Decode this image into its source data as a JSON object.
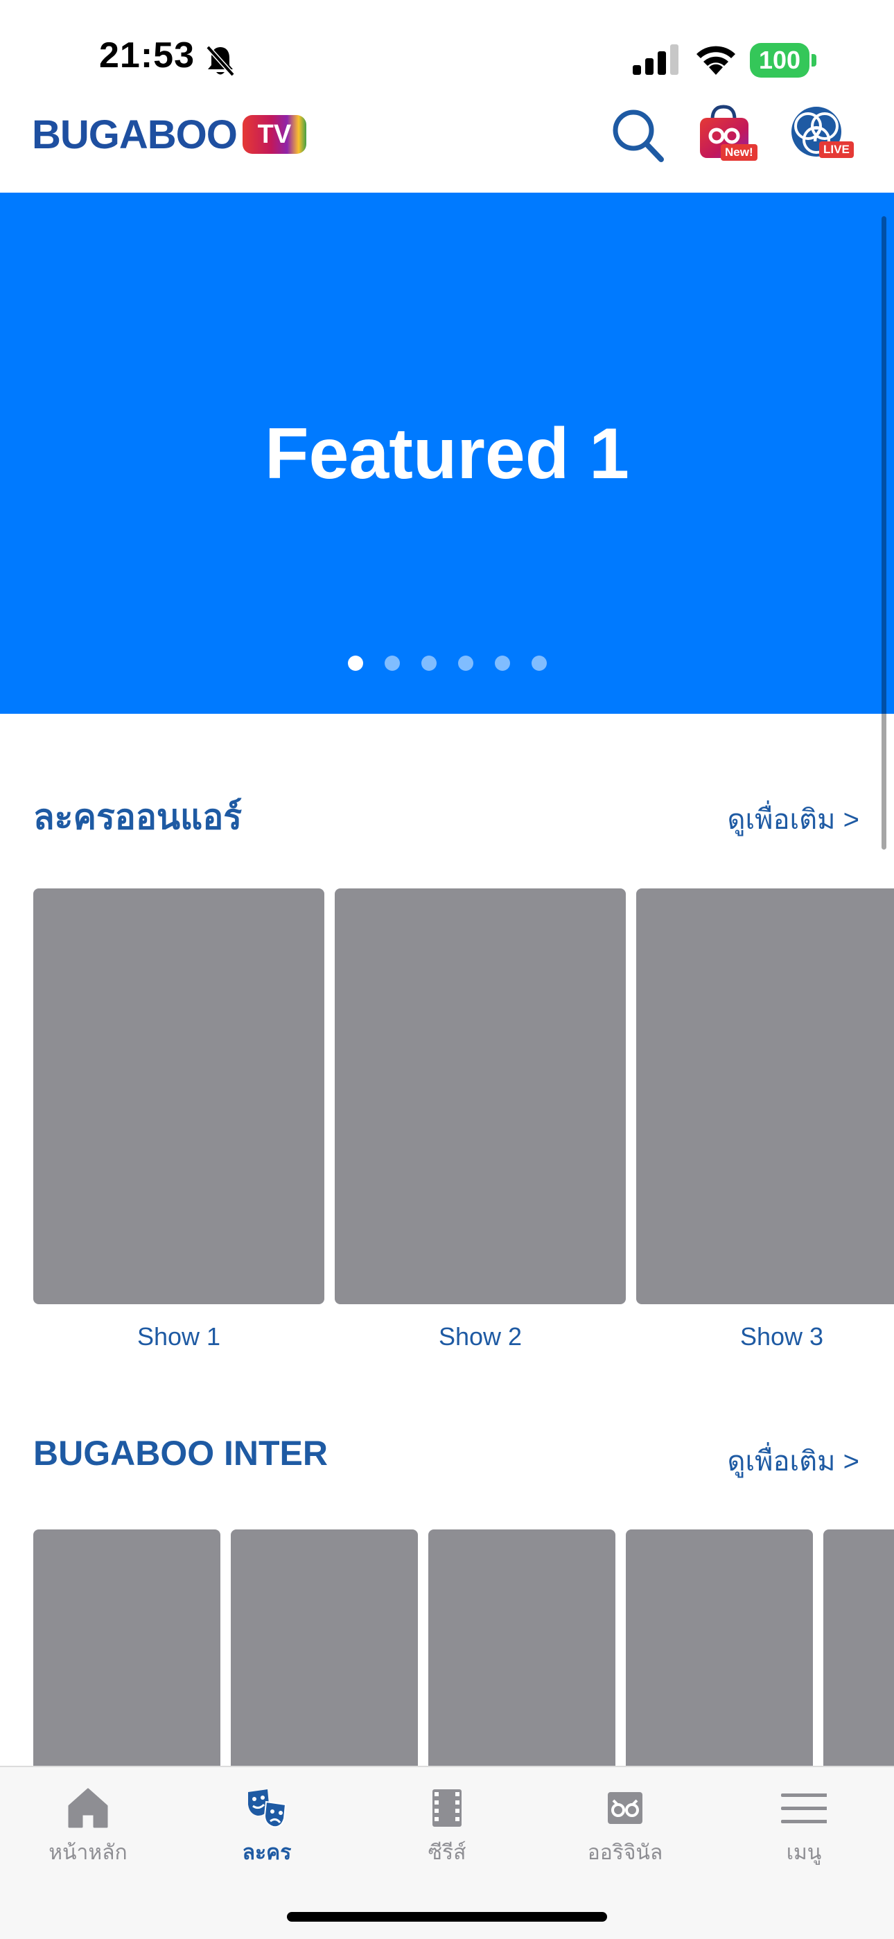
{
  "status_bar": {
    "time": "21:53",
    "battery": "100",
    "icons": [
      "bell-slash-icon",
      "cellular-signal-icon",
      "wifi-icon",
      "battery-icon"
    ]
  },
  "header": {
    "logo_text": "BUGABOO",
    "logo_badge": "TV",
    "shop_badge": "New!",
    "live_badge": "LIVE",
    "icons": [
      "search-icon",
      "shop-bag-icon",
      "live-channel-icon"
    ]
  },
  "featured": {
    "title": "Featured 1",
    "dot_count": 6,
    "active_dot": 0,
    "background": "#007aff"
  },
  "sections": [
    {
      "title": "ละครออนแอร์",
      "see_more": "ดูเพื่อเติม >",
      "items": [
        "Show 1",
        "Show 2",
        "Show 3"
      ]
    },
    {
      "title": "BUGABOO INTER",
      "see_more": "ดูเพื่อเติม >",
      "items": [
        "",
        "",
        "",
        "",
        ""
      ]
    }
  ],
  "tabs": [
    {
      "label": "หน้าหลัก",
      "icon": "home-icon",
      "active": false
    },
    {
      "label": "ละคร",
      "icon": "drama-masks-icon",
      "active": true
    },
    {
      "label": "ซีรีส์",
      "icon": "film-strip-icon",
      "active": false
    },
    {
      "label": "ออริจินัล",
      "icon": "original-icon",
      "active": false
    },
    {
      "label": "เมนู",
      "icon": "menu-icon",
      "active": false
    }
  ],
  "colors": {
    "brand_blue": "#1e5aa3",
    "banner_blue": "#007aff",
    "placeholder_gray": "#8e8e93",
    "battery_green": "#34c759"
  }
}
